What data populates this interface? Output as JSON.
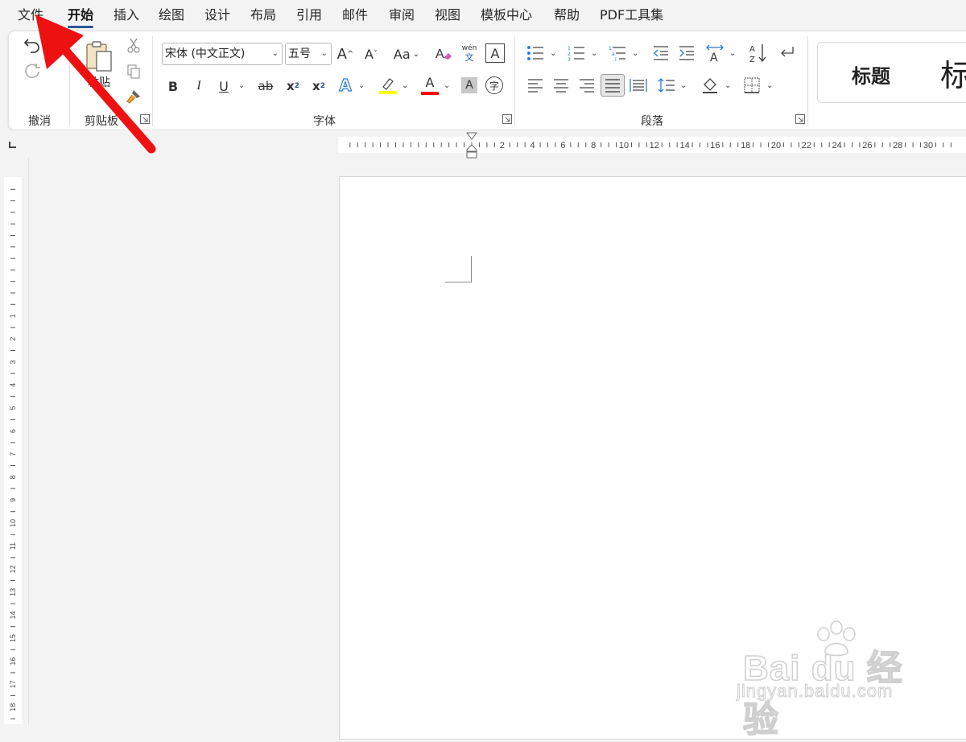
{
  "menu": {
    "items": [
      "文件",
      "开始",
      "插入",
      "绘图",
      "设计",
      "布局",
      "引用",
      "邮件",
      "审阅",
      "视图",
      "模板中心",
      "帮助",
      "PDF工具集"
    ],
    "active_index": 1
  },
  "ribbon": {
    "undo_group_label": "撤消",
    "clipboard_group_label": "剪贴板",
    "paste_label": "粘贴",
    "font_group_label": "字体",
    "paragraph_group_label": "段落",
    "font_name": "宋体 (中文正文)",
    "font_size": "五号",
    "grow_font_label": "A",
    "shrink_font_label": "A",
    "change_case_label": "Aa",
    "phonetic_top": "wén",
    "phonetic_bottom": "文",
    "char_border_label": "A",
    "bold_label": "B",
    "italic_label": "I",
    "underline_label": "U",
    "strike_label": "ab",
    "subscript_label": "x",
    "superscript_label": "x",
    "text_effects_label": "A",
    "font_color_label": "A",
    "char_shading_label": "A",
    "enclose_char_label": "字",
    "style_heading_label": "标题",
    "style_heading2_label": "标",
    "colors": {
      "highlight": "#ffff00",
      "font_color": "#ff0000",
      "accent": "#2b579a",
      "arrow": "#ee1111"
    }
  },
  "ruler": {
    "numbers": [
      "2",
      "4",
      "6",
      "8",
      "10",
      "12",
      "14",
      "16",
      "18",
      "20",
      "22",
      "24",
      "26",
      "28",
      "30"
    ],
    "v_numbers": [
      "1",
      "2",
      "3",
      "4",
      "5",
      "6",
      "7",
      "8",
      "9",
      "10",
      "11",
      "12",
      "13",
      "14",
      "15",
      "16",
      "17",
      "18",
      "19"
    ]
  },
  "watermark": {
    "brand": "Bai du 经验",
    "sub": "jingyan.baidu.com"
  }
}
